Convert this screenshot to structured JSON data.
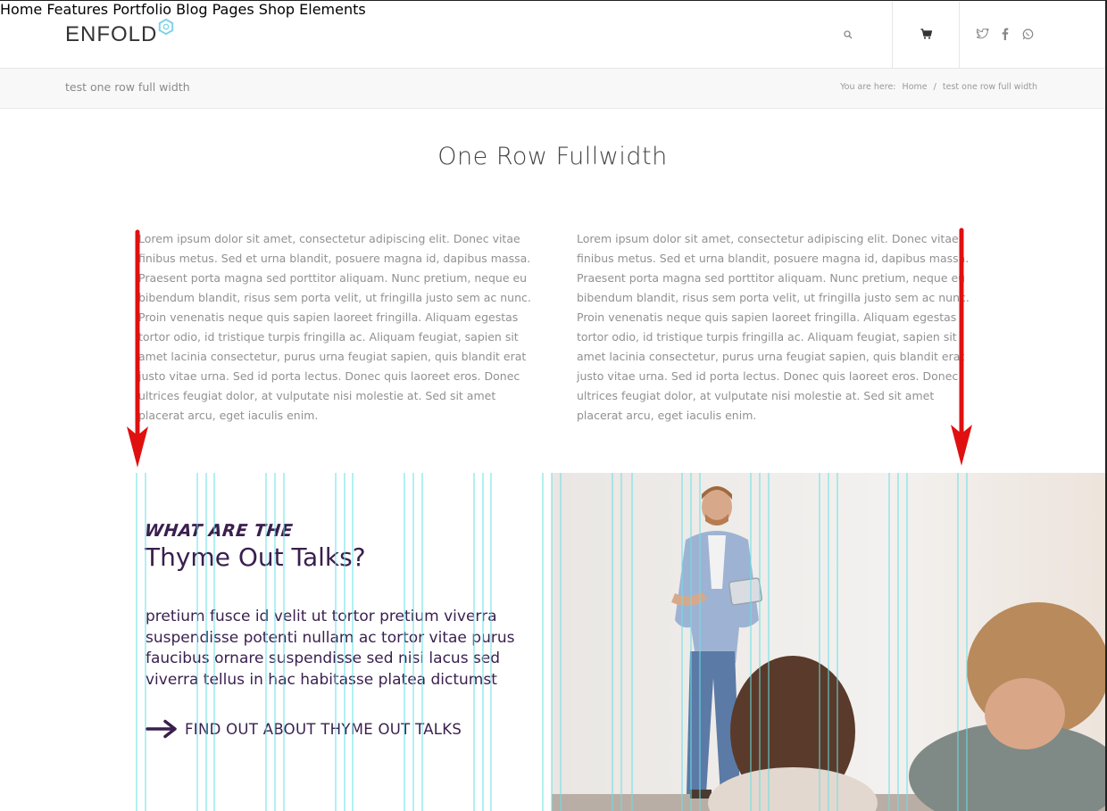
{
  "header": {
    "logo_text": "ENFOLD",
    "nav": [
      "Home",
      "Features",
      "Portfolio",
      "Blog",
      "Pages",
      "Shop",
      "Elements"
    ],
    "icons": [
      "search-icon",
      "cart-icon",
      "twitter-icon",
      "facebook-icon",
      "whatsapp-icon"
    ]
  },
  "titlebar": {
    "page_label": "test one row full width",
    "breadcrumb_prefix": "You are here:",
    "breadcrumb_home": "Home",
    "breadcrumb_sep": "/",
    "breadcrumb_current": "test one row full width"
  },
  "main": {
    "title": "One Row Fullwidth",
    "columns": [
      "Lorem ipsum dolor sit amet, consectetur adipiscing elit. Donec vitae finibus metus. Sed et urna blandit, posuere magna id, dapibus massa. Praesent porta magna sed porttitor aliquam. Nunc pretium, neque eu bibendum blandit, risus sem porta velit, ut fringilla justo sem ac nunc. Proin venenatis neque quis sapien laoreet fringilla. Aliquam egestas tortor odio, id tristique turpis fringilla ac. Aliquam feugiat, sapien sit amet lacinia consectetur, purus urna feugiat sapien, quis blandit erat justo vitae urna. Sed id porta lectus. Donec quis laoreet eros. Donec ultrices feugiat dolor, at vulputate nisi molestie at. Sed sit amet placerat arcu, eget iaculis enim.",
      "Lorem ipsum dolor sit amet, consectetur adipiscing elit. Donec vitae finibus metus. Sed et urna blandit, posuere magna id, dapibus massa. Praesent porta magna sed porttitor aliquam. Nunc pretium, neque eu bibendum blandit, risus sem porta velit, ut fringilla justo sem ac nunc. Proin venenatis neque quis sapien laoreet fringilla. Aliquam egestas tortor odio, id tristique turpis fringilla ac. Aliquam feugiat, sapien sit amet lacinia consectetur, purus urna feugiat sapien, quis blandit erat justo vitae urna. Sed id porta lectus. Donec quis laoreet eros. Donec ultrices feugiat dolor, at vulputate nisi molestie at. Sed sit amet placerat arcu, eget iaculis enim."
    ]
  },
  "promo": {
    "kicker": "WHAT ARE THE",
    "headline": "Thyme Out Talks?",
    "body": "pretium fusce id velit ut tortor pretium viverra suspendisse potenti nullam ac tortor vitae purus faucibus ornare suspendisse sed nisi lacus sed viverra tellus in hac habitasse platea dictumst",
    "cta_label": "FIND OUT ABOUT THYME OUT TALKS",
    "cta_icon": "arrow-right-icon"
  },
  "colors": {
    "accent_purple": "#3a1f4e",
    "annotation_red": "#e01010",
    "guide_cyan": "#66e0e6",
    "logo_hex": "#7fd3e6"
  }
}
